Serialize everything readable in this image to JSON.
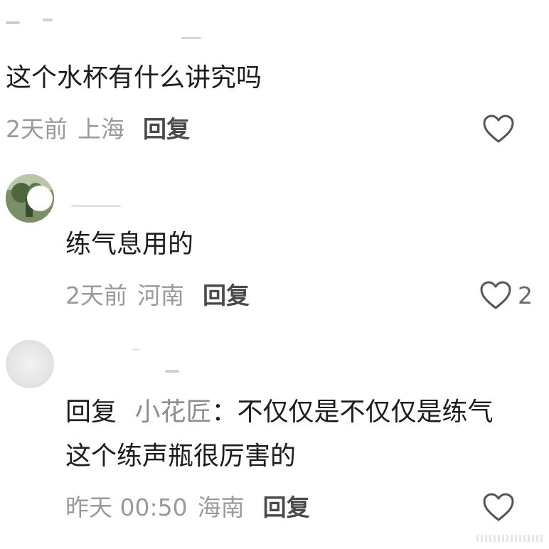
{
  "comments": [
    {
      "text": "这个水杯有什么讲究吗",
      "time": "2天前",
      "location": "上海",
      "reply_label": "回复",
      "like_count": ""
    },
    {
      "text": "练气息用的",
      "time": "2天前",
      "location": "河南",
      "reply_label": "回复",
      "like_count": "2"
    },
    {
      "reply_prefix": "回复",
      "reply_target": "小花匠",
      "reply_colon": "：",
      "text_line1": "不仅仅是不仅仅是练气",
      "text_line2": "这个练声瓶很厉害的",
      "time": "昨天 00:50",
      "location": "海南",
      "reply_label": "回复",
      "like_count": ""
    }
  ],
  "icons": {
    "like": "heart-outline-icon"
  },
  "colors": {
    "meta_text": "#9a9a9a",
    "reply_button": "#4a4a4a",
    "body_text": "#1c1c1c",
    "reply_target": "#8e8e8e"
  }
}
